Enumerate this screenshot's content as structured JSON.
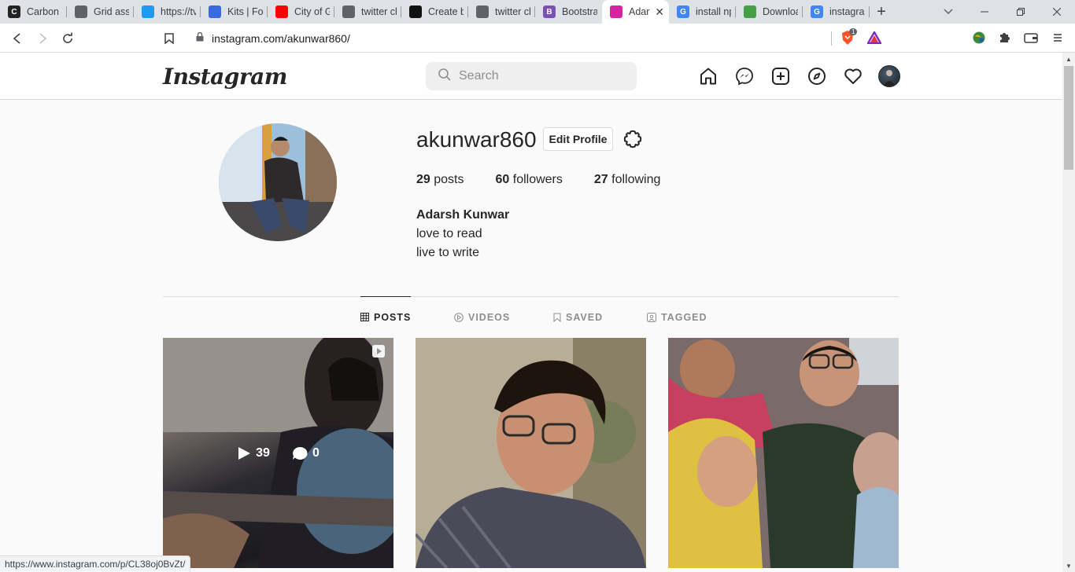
{
  "browser": {
    "tabs": [
      {
        "label": "Carbon |",
        "favicon_color": "#222222",
        "glyph": "C"
      },
      {
        "label": "Grid assi",
        "favicon_color": "#5f6368",
        "glyph": ""
      },
      {
        "label": "https://tv",
        "favicon_color": "#1d9bf0",
        "glyph": ""
      },
      {
        "label": "Kits | For",
        "favicon_color": "#3a6ae0",
        "glyph": ""
      },
      {
        "label": "City of G",
        "favicon_color": "#ff0000",
        "glyph": ""
      },
      {
        "label": "twitter cl",
        "favicon_color": "#5f6368",
        "glyph": ""
      },
      {
        "label": "Create b",
        "favicon_color": "#111111",
        "glyph": ""
      },
      {
        "label": "twitter cl",
        "favicon_color": "#5f6368",
        "glyph": ""
      },
      {
        "label": "Bootstra",
        "favicon_color": "#7952b3",
        "glyph": "B"
      },
      {
        "label": "Adar",
        "favicon_color": "#d6249f",
        "glyph": "",
        "active": true
      },
      {
        "label": "install np",
        "favicon_color": "#4285f4",
        "glyph": "G"
      },
      {
        "label": "Downloa",
        "favicon_color": "#43a047",
        "glyph": ""
      },
      {
        "label": "instagrar",
        "favicon_color": "#4285f4",
        "glyph": "G"
      }
    ],
    "url": "instagram.com/akunwar860/",
    "brave_badge": "1",
    "status_url": "https://www.instagram.com/p/CL38oj0BvZt/"
  },
  "ig": {
    "logo": "Instagram",
    "search_placeholder": "Search",
    "username": "akunwar860",
    "edit_profile": "Edit Profile",
    "stats": {
      "posts_count": "29",
      "posts_label": "posts",
      "followers_count": "60",
      "followers_label": "followers",
      "following_count": "27",
      "following_label": "following"
    },
    "full_name": "Adarsh Kunwar",
    "bio": [
      "love to read",
      "live to write"
    ],
    "tabs": [
      {
        "label": "POSTS",
        "active": true
      },
      {
        "label": "VIDEOS"
      },
      {
        "label": "SAVED"
      },
      {
        "label": "TAGGED"
      }
    ],
    "posts": [
      {
        "type": "video",
        "views": "39",
        "comments": "0",
        "hovered": true
      },
      {
        "type": "photo"
      },
      {
        "type": "photo"
      }
    ]
  }
}
